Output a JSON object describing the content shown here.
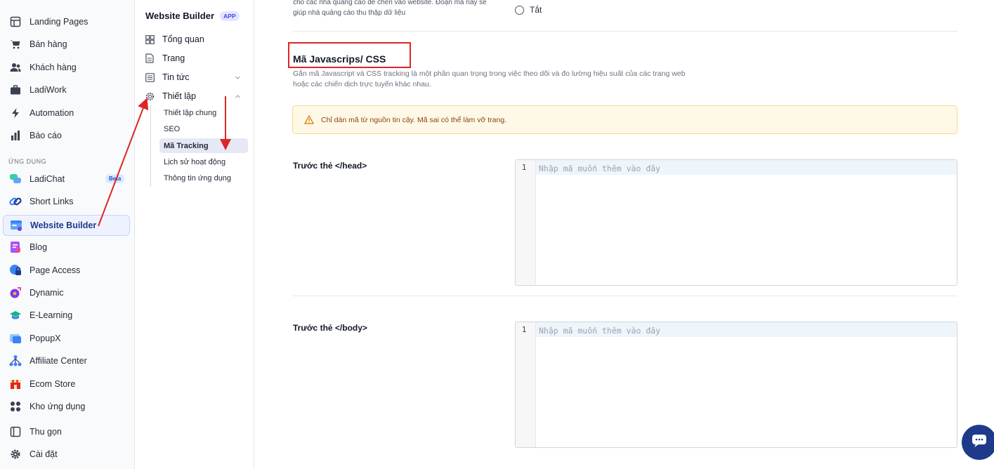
{
  "app_sidebar": {
    "items": [
      {
        "label": "Landing Pages",
        "icon": "layout-icon"
      },
      {
        "label": "Bán hàng",
        "icon": "cart-icon"
      },
      {
        "label": "Khách hàng",
        "icon": "users-icon"
      },
      {
        "label": "LadiWork",
        "icon": "briefcase-icon"
      },
      {
        "label": "Automation",
        "icon": "lightning-icon"
      },
      {
        "label": "Báo cáo",
        "icon": "bar-chart-icon"
      }
    ],
    "section_label": "ỨNG DỤNG",
    "apps": [
      {
        "label": "LadiChat",
        "icon": "chat-icon",
        "badge": "Beta"
      },
      {
        "label": "Short Links",
        "icon": "link-icon"
      },
      {
        "label": "Website Builder",
        "icon": "website-icon",
        "active": true
      },
      {
        "label": "Blog",
        "icon": "blog-icon"
      },
      {
        "label": "Page Access",
        "icon": "lock-icon"
      },
      {
        "label": "Dynamic",
        "icon": "dynamic-icon"
      },
      {
        "label": "E-Learning",
        "icon": "graduation-icon"
      },
      {
        "label": "PopupX",
        "icon": "popup-icon"
      },
      {
        "label": "Affiliate Center",
        "icon": "network-icon"
      },
      {
        "label": "Ecom Store",
        "icon": "store-icon"
      },
      {
        "label": "Kho ứng dụng",
        "icon": "apps-grid-icon"
      }
    ],
    "bottom": [
      {
        "label": "Thu gọn",
        "icon": "collapse-icon"
      },
      {
        "label": "Cài đặt",
        "icon": "gear-icon"
      }
    ]
  },
  "sub_sidebar": {
    "title": "Website Builder",
    "tag": "APP",
    "items": [
      {
        "label": "Tổng quan",
        "icon": "dashboard-icon"
      },
      {
        "label": "Trang",
        "icon": "page-icon"
      },
      {
        "label": "Tin tức",
        "icon": "news-icon"
      },
      {
        "label": "Thiết lập",
        "icon": "settings-icon"
      }
    ],
    "children": [
      {
        "label": "Thiết lập chung"
      },
      {
        "label": "SEO"
      },
      {
        "label": "Mã Tracking",
        "active": true
      },
      {
        "label": "Lịch sử hoạt động"
      },
      {
        "label": "Thông tin ứng dụng"
      }
    ]
  },
  "main": {
    "top_text": "cho các nhà quảng cáo để chèn vào website. Đoạn mã này sẽ giúp nhà quảng cáo thu thập dữ liệu",
    "radio_label": "Tắt",
    "section_title": "Mã Javascrips/ CSS",
    "section_desc": "Gắn mã Javascript và CSS tracking là một phần quan trọng trong việc theo dõi và đo lường hiệu suất của các trang web hoặc các chiến dịch trực tuyến khác nhau.",
    "warning": "Chỉ dán mã từ nguồn tin cậy. Mã sai có thể làm vỡ trang.",
    "head_label": "Trước thẻ </head>",
    "body_label": "Trước thẻ </body>",
    "editor_line": "1",
    "editor_placeholder": "Nhập mã muốn thêm vào đây"
  },
  "colors": {
    "accent": "#4f46e5",
    "highlight": "#dc2626",
    "warning_bg": "#fef9e7"
  }
}
